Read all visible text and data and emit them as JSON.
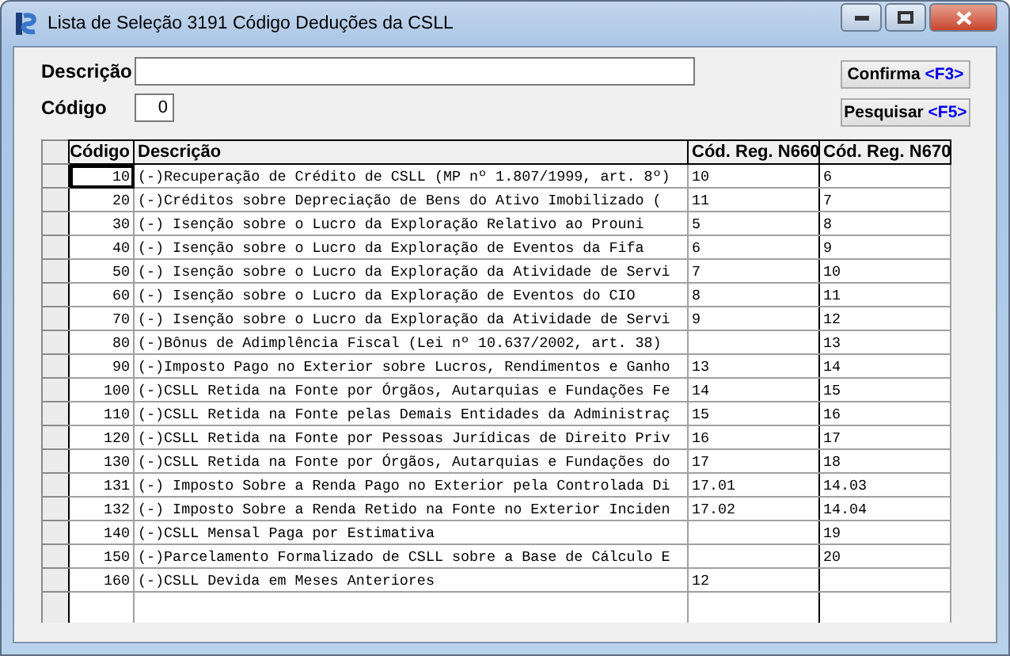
{
  "window": {
    "title": "Lista de Seleção 3191 Código Deduções da CSLL"
  },
  "filters": [
    {
      "label": "Descrição",
      "kind": "wide"
    },
    {
      "label": "Código",
      "value": "0",
      "kind": "narrow"
    }
  ],
  "buttons": [
    {
      "label": "Confirma",
      "shortcut": "<F3>"
    },
    {
      "label": "Pesquisar",
      "shortcut": "<F5>"
    }
  ],
  "table": {
    "columns": [
      "Código",
      "Descrição",
      "Cód. Reg. N660",
      "Cód. Reg. N670"
    ],
    "rows": [
      {
        "codigo": "10",
        "descricao": "(-)Recuperação de Crédito de CSLL (MP nº 1.807/1999, art. 8º)",
        "n660": "10",
        "n670": "6",
        "selected": true
      },
      {
        "codigo": "20",
        "descricao": "(-)Créditos sobre Depreciação de Bens do Ativo Imobilizado (",
        "n660": "11",
        "n670": "7",
        "selected": false
      },
      {
        "codigo": "30",
        "descricao": "(-) Isenção sobre o Lucro da Exploração Relativo ao Prouni",
        "n660": "5",
        "n670": "8",
        "selected": false
      },
      {
        "codigo": "40",
        "descricao": "(-) Isenção sobre o Lucro da Exploração de Eventos da Fifa",
        "n660": "6",
        "n670": "9",
        "selected": false
      },
      {
        "codigo": "50",
        "descricao": "(-) Isenção sobre o Lucro da Exploração da Atividade de Servi",
        "n660": "7",
        "n670": "10",
        "selected": false
      },
      {
        "codigo": "60",
        "descricao": "(-) Isenção sobre o Lucro da Exploração de Eventos do CIO",
        "n660": "8",
        "n670": "11",
        "selected": false
      },
      {
        "codigo": "70",
        "descricao": "(-) Isenção sobre o Lucro da Exploração da Atividade de Servi",
        "n660": "9",
        "n670": "12",
        "selected": false
      },
      {
        "codigo": "80",
        "descricao": "(-)Bônus de Adimplência Fiscal (Lei nº 10.637/2002, art. 38)",
        "n660": "",
        "n670": "13",
        "selected": false
      },
      {
        "codigo": "90",
        "descricao": "(-)Imposto Pago no Exterior sobre Lucros, Rendimentos e Ganho",
        "n660": "13",
        "n670": "14",
        "selected": false
      },
      {
        "codigo": "100",
        "descricao": "(-)CSLL Retida na Fonte por Órgãos, Autarquias e Fundações Fe",
        "n660": "14",
        "n670": "15",
        "selected": false
      },
      {
        "codigo": "110",
        "descricao": "(-)CSLL Retida na Fonte pelas Demais Entidades da Administraç",
        "n660": "15",
        "n670": "16",
        "selected": false
      },
      {
        "codigo": "120",
        "descricao": "(-)CSLL Retida na Fonte por Pessoas Jurídicas de Direito Priv",
        "n660": "16",
        "n670": "17",
        "selected": false
      },
      {
        "codigo": "130",
        "descricao": "(-)CSLL Retida na Fonte por Órgãos, Autarquias e Fundações do",
        "n660": "17",
        "n670": "18",
        "selected": false
      },
      {
        "codigo": "131",
        "descricao": "(-) Imposto Sobre a Renda Pago no Exterior pela Controlada Di",
        "n660": "17.01",
        "n670": "14.03",
        "selected": false
      },
      {
        "codigo": "132",
        "descricao": "(-) Imposto Sobre a Renda Retido na Fonte no Exterior Inciden",
        "n660": "17.02",
        "n670": "14.04",
        "selected": false
      },
      {
        "codigo": "140",
        "descricao": "(-)CSLL Mensal Paga por Estimativa",
        "n660": "",
        "n670": "19",
        "selected": false
      },
      {
        "codigo": "150",
        "descricao": "(-)Parcelamento Formalizado de CSLL sobre a Base de Cálculo E",
        "n660": "",
        "n670": "20",
        "selected": false
      },
      {
        "codigo": "160",
        "descricao": "(-)CSLL Devida em Meses Anteriores",
        "n660": "12",
        "n670": "",
        "selected": false
      }
    ]
  }
}
